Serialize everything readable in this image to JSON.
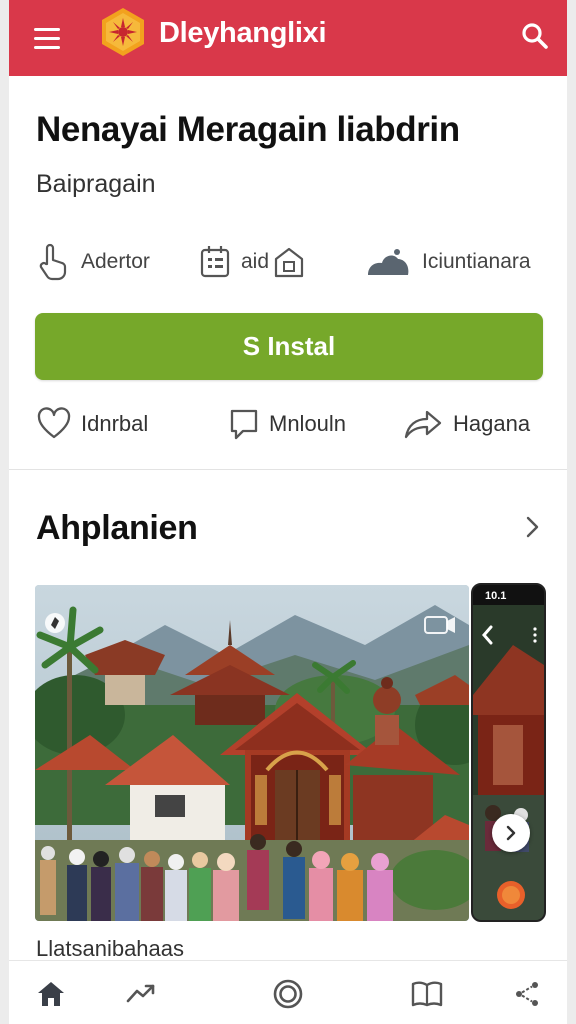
{
  "header": {
    "app_name": "Dleyhanglixi",
    "menu_icon": "hamburger-menu-icon",
    "search_icon": "search-icon",
    "logo_icon": "sun-emblem-logo",
    "color": "#d9384a"
  },
  "app": {
    "title": "Nenayai Meragain liabdrin",
    "subtitle": "Baipragain"
  },
  "meta": [
    {
      "label": "Adertor",
      "icon": "hand-pointer-icon"
    },
    {
      "label": "aid",
      "icon": "info-card-icon"
    },
    {
      "label": "Iciuntianara",
      "icon": "cloud-icon"
    }
  ],
  "install": {
    "label": "S Instal",
    "color": "#76a82a"
  },
  "actions": [
    {
      "label": "Idnrbal",
      "icon": "heart-icon"
    },
    {
      "label": "Mnlouln",
      "icon": "comment-icon"
    },
    {
      "label": "Hagana",
      "icon": "share-icon"
    }
  ],
  "section": {
    "title": "Ahplanien",
    "chevron_icon": "chevron-right-icon"
  },
  "gallery": {
    "video_badge": "video-icon",
    "side_status": "10.1",
    "next_icon": "chevron-right-icon"
  },
  "caption": "Llatsanibahaas",
  "bottom_nav": [
    {
      "name": "home",
      "icon": "home-icon"
    },
    {
      "name": "trending",
      "icon": "trending-icon"
    },
    {
      "name": "circle",
      "icon": "target-icon"
    },
    {
      "name": "library",
      "icon": "book-icon"
    },
    {
      "name": "share",
      "icon": "share-nodes-icon"
    }
  ]
}
